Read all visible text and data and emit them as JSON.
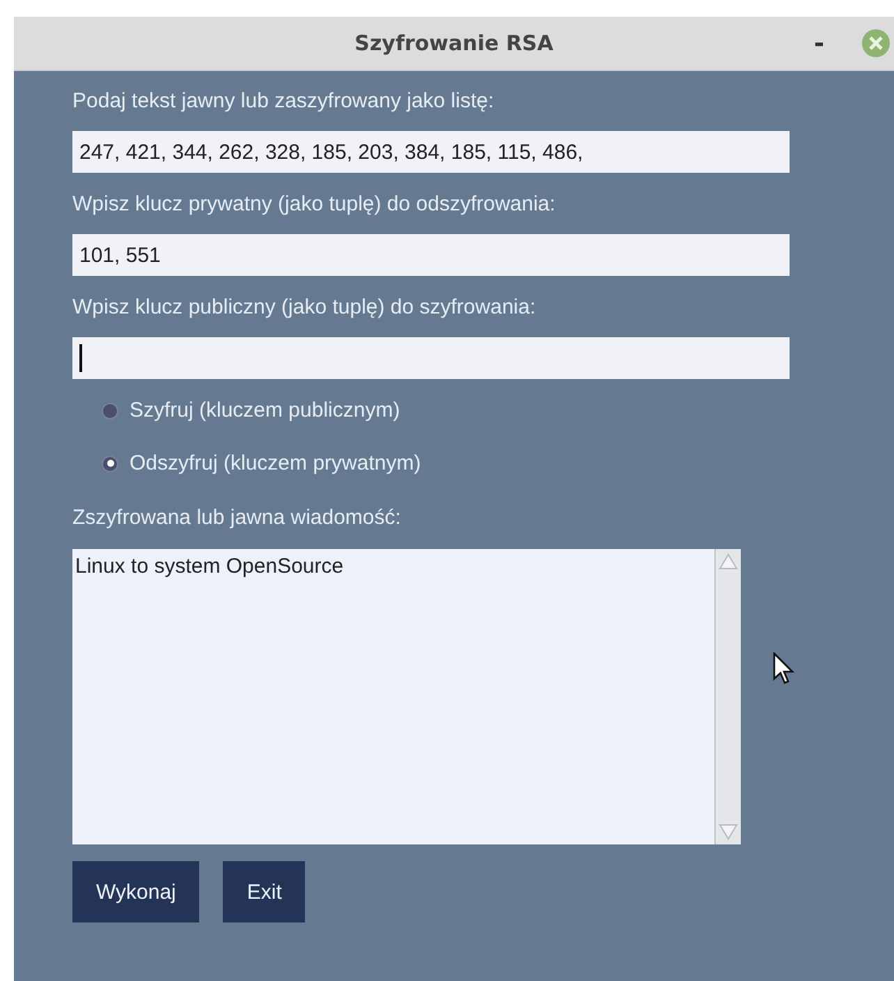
{
  "window": {
    "title": "Szyfrowanie RSA",
    "buttons": [
      "-"
    ]
  },
  "fields": [
    {
      "label": "Podaj tekst jawny lub zaszyfrowany jako listę:",
      "value": "247, 421, 344, 262, 328, 185, 203, 384, 185, 115, 486,",
      "focused": false
    },
    {
      "label": "Wpisz klucz prywatny (jako tuplę) do odszyfrowania:",
      "value": "101, 551",
      "focused": false
    },
    {
      "label": "Wpisz klucz publiczny (jako tuplę) do szyfrowania:",
      "focused": true
    }
  ],
  "radios": [
    {
      "label": "Szyfruj (kluczem publicznym)",
      "selected": false
    },
    {
      "label": "Odszyfruj (kluczem prywatnym)",
      "selected": true
    }
  ],
  "output": {
    "label": "Zszyfrowana lub jawna wiadomość:",
    "value": "Linux to system OpenSource"
  },
  "actions": [
    "Wykonaj",
    "Exit"
  ]
}
